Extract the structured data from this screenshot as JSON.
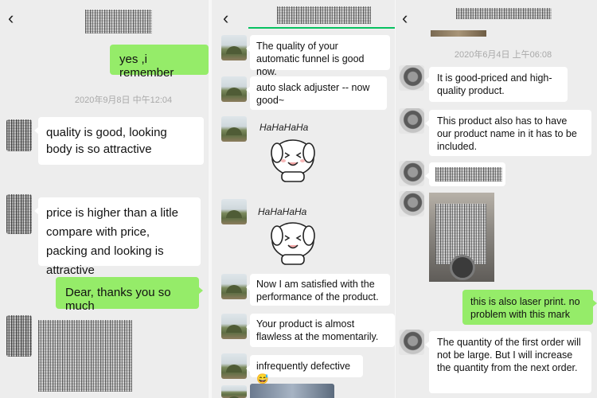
{
  "panel1": {
    "messages": [
      {
        "text": "yes ,i remember"
      },
      {
        "text": "quality is good, looking body is so attractive"
      },
      {
        "text": "price is higher than a litle compare with price, packing and looking is attractive"
      },
      {
        "text": "Dear, thanks you so much"
      }
    ],
    "timestamp": "2020年9月8日 中午12:04"
  },
  "panel2": {
    "messages": [
      {
        "text": "The quality of your automatic funnel is good now."
      },
      {
        "text": "auto slack adjuster --  now good~"
      },
      {
        "text": "Now I am satisfied with the performance of the product."
      },
      {
        "text": "Your product is almost flawless at the momentarily."
      },
      {
        "text": "infrequently defective😅"
      }
    ],
    "stickers": [
      {
        "caption": "HaHaHaHa"
      },
      {
        "caption": "HaHaHaHa"
      }
    ]
  },
  "panel3": {
    "timestamp": "2020年6月4日 上午06:08",
    "messages": [
      {
        "text": "It is good-priced and high-quality product."
      },
      {
        "text": "This product also has to have our product name in it has to be included."
      },
      {
        "text": "this is also laser print. no problem with this mark"
      },
      {
        "text": "The quantity of the first order will not be large. But I will increase the quantity from the next order."
      }
    ]
  },
  "icons": {
    "back": "chevron-left-icon"
  },
  "colors": {
    "incoming": "#ffffff",
    "outgoing": "#95ec69",
    "background": "#ededed",
    "accent": "#07c160"
  }
}
